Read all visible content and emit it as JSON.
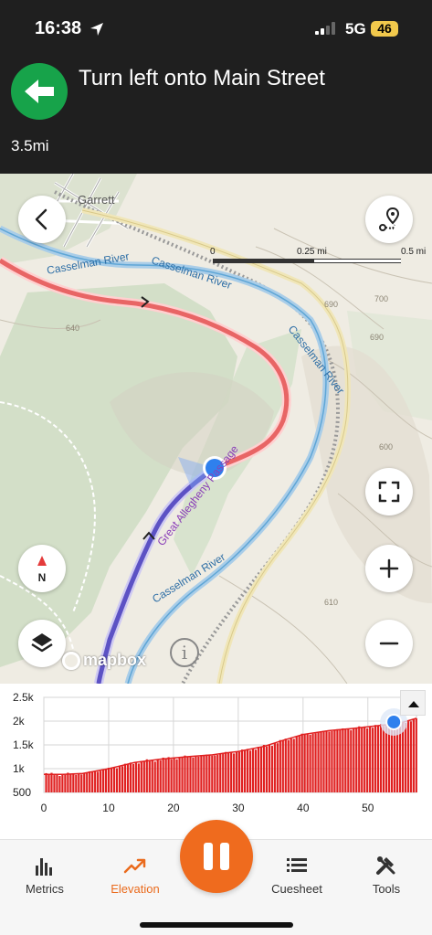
{
  "status_bar": {
    "time": "16:38",
    "network": "5G",
    "battery": "46"
  },
  "navigation": {
    "instruction": "Turn left onto Main Street",
    "distance": "3.5mi",
    "turn_icon": "arrow-left-icon",
    "accent": "#17a34a"
  },
  "map": {
    "labels": {
      "town": "Garrett",
      "river": "Casselman River",
      "trail": "Great Allegheny Passage",
      "contours": [
        "690",
        "640",
        "700",
        "690",
        "600",
        "610"
      ]
    },
    "scale": {
      "start": "0",
      "mid": "0.25 mi",
      "end": "0.5 mi"
    },
    "compass_label": "N",
    "attribution": "mapbox",
    "info_symbol": "i",
    "route_ahead_color": "#ea6a6a",
    "route_done_color": "#5f53c8",
    "position_color": "#2f80ed"
  },
  "elevation": {
    "y_ticks": [
      "2.5k",
      "2k",
      "1.5k",
      "1k",
      "500"
    ],
    "x_ticks": [
      "0",
      "10",
      "20",
      "30",
      "40",
      "50"
    ],
    "bar_color": "#e02020"
  },
  "chart_data": {
    "type": "area",
    "title": "",
    "xlabel": "",
    "ylabel": "",
    "xlim": [
      0,
      57.5
    ],
    "ylim": [
      500,
      2500
    ],
    "x": [
      0,
      3,
      6,
      10,
      14,
      18,
      22,
      26,
      28,
      30,
      34,
      37,
      40,
      44,
      48,
      52,
      55,
      57.5
    ],
    "values": [
      880,
      880,
      900,
      1000,
      1130,
      1200,
      1250,
      1290,
      1330,
      1360,
      1470,
      1600,
      1720,
      1800,
      1850,
      1910,
      1960,
      2060
    ],
    "current_position_x": 54,
    "grid": true
  },
  "tabs": [
    {
      "label": "Metrics",
      "icon": "bar-chart-icon"
    },
    {
      "label": "Elevation",
      "icon": "trend-line-icon"
    },
    {
      "label": "Cuesheet",
      "icon": "list-icon"
    },
    {
      "label": "Tools",
      "icon": "tools-icon"
    }
  ],
  "active_tab": "Elevation",
  "pause_color": "#ef6b1e"
}
